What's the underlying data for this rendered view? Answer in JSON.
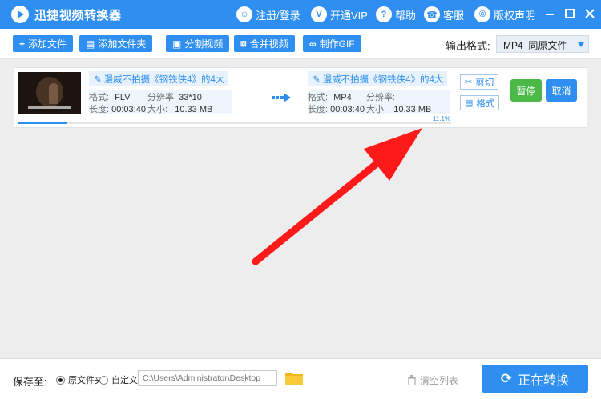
{
  "app": {
    "title": "迅捷视频转换器"
  },
  "titlebar": {
    "nav": [
      {
        "icon": "user-icon",
        "glyph": "☺",
        "label": "注册/登录"
      },
      {
        "icon": "vip-icon",
        "glyph": "V",
        "label": "开通VIP"
      },
      {
        "icon": "help-icon",
        "glyph": "?",
        "label": "帮助"
      },
      {
        "icon": "headset-icon",
        "glyph": "☎",
        "label": "客服"
      },
      {
        "icon": "copyright-icon",
        "glyph": "©",
        "label": "版权声明"
      }
    ]
  },
  "toolbar": {
    "add_file": "添加文件",
    "add_folder": "添加文件夹",
    "split_video": "分割视频",
    "merge_video": "合并视频",
    "make_gif": "制作GIF",
    "output_format_label": "输出格式:",
    "output_format_value": "MP4  同原文件"
  },
  "task": {
    "source_name": "漫威不拍摄《钢铁侠4》的4大...",
    "target_name": "漫威不拍摄《钢铁侠4》的4大...",
    "labels": {
      "format": "格式:",
      "resolution": "分辨率:",
      "duration": "长度:",
      "size": "大小:"
    },
    "source": {
      "format": "FLV",
      "resolution": "33*10",
      "duration": "00:03:40",
      "size": "10.33 MB"
    },
    "target": {
      "format": "MP4",
      "resolution": "",
      "duration": "00:03:40",
      "size": "10.33 MB"
    },
    "progress_text": "11.1%",
    "progress_fraction": 0.111,
    "cut_label": "剪切",
    "format_label": "格式",
    "pause_label": "暂停",
    "cancel_label": "取消"
  },
  "bottom": {
    "save_to_label": "保存至:",
    "radio_original": "原文件夹",
    "radio_custom": "自定义",
    "path_value": "C:\\Users\\Administrator\\Desktop",
    "clear_list": "清空列表",
    "convert_label": "正在转换"
  },
  "colors": {
    "accent": "#2f8ff0",
    "pause": "#4cb846",
    "annotation_arrow": "#ff1a1a"
  }
}
